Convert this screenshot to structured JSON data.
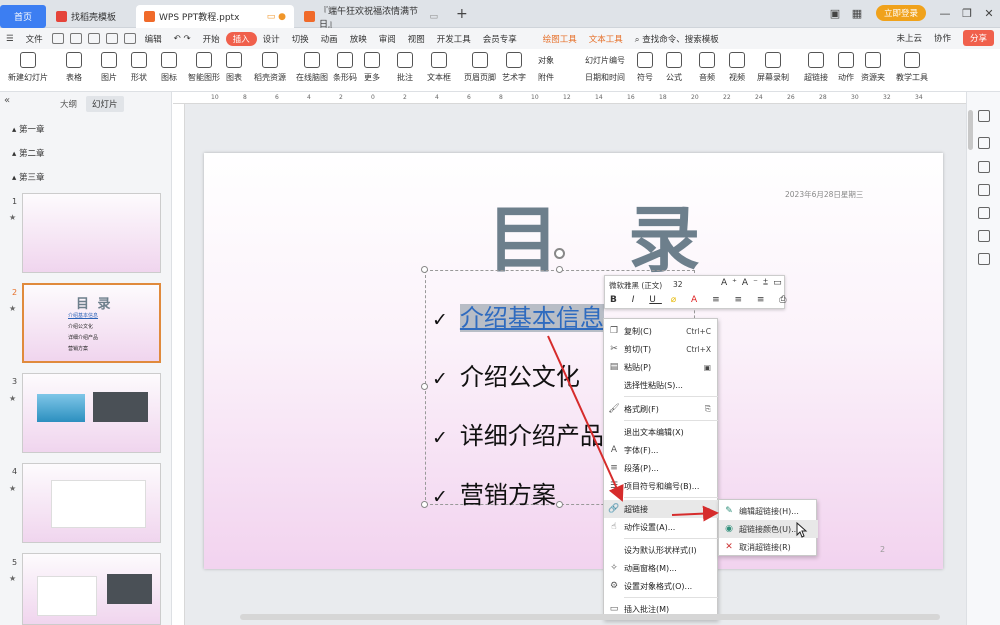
{
  "tabs": {
    "home": "首页",
    "find_template": "找稻壳模板",
    "current_file": "WPS PPT教程.pptx",
    "other_file": "『端午狂欢祝福浓情满节日』",
    "login": "立即登录"
  },
  "menu": {
    "file": "文件",
    "items": [
      "编辑",
      "开始",
      "插入",
      "设计",
      "切换",
      "动画",
      "放映",
      "审阅",
      "视图",
      "开发工具",
      "会员专享"
    ],
    "context_tools": [
      "绘图工具",
      "文本工具"
    ],
    "search_placeholder": "查找命令、搜索模板",
    "cloud": "未上云",
    "collab": "协作",
    "share": "分享"
  },
  "ribbon": {
    "items": [
      "新建幻灯片",
      "表格",
      "图片",
      "形状",
      "图标",
      "智能图形",
      "图表",
      "稻壳资源",
      "在线脑图",
      "条形码",
      "更多",
      "批注",
      "文本框",
      "页眉页脚",
      "艺术字",
      "音频",
      "视频",
      "屏幕录制",
      "超链接",
      "动作",
      "资源夹",
      "教学工具"
    ],
    "small": [
      "对象",
      "幻灯片编号",
      "附件",
      "日期和时间",
      "符号",
      "公式"
    ]
  },
  "left_panel": {
    "tab_outline": "大纲",
    "tab_slides": "幻灯片",
    "chapters": [
      "第一章",
      "第二章",
      "第三章"
    ],
    "slide_numbers": [
      "1",
      "2",
      "3",
      "4",
      "5"
    ],
    "thumb2_title": "目 录",
    "thumb2_items": [
      "介绍基本信息",
      "介绍公文化",
      "详细介绍产品",
      "营销方案"
    ]
  },
  "slide": {
    "title": "目 录",
    "date": "2023年6月28日星期三",
    "page_number": "2",
    "bullets": [
      "介绍基本信息",
      "介绍公文化",
      "详细介绍产品",
      "营销方案"
    ]
  },
  "format_bar": {
    "font": "微软雅黑 (正文)",
    "size": "32"
  },
  "context_menu": {
    "items": [
      {
        "label": "复制(C)",
        "shortcut": "Ctrl+C"
      },
      {
        "label": "剪切(T)",
        "shortcut": "Ctrl+X"
      },
      {
        "label": "粘贴(P)",
        "shortcut": ""
      },
      {
        "label": "选择性粘贴(S)...",
        "shortcut": ""
      },
      {
        "label": "格式刷(F)",
        "shortcut": ""
      },
      {
        "label": "退出文本编辑(X)",
        "shortcut": ""
      },
      {
        "label": "字体(F)...",
        "shortcut": ""
      },
      {
        "label": "段落(P)...",
        "shortcut": ""
      },
      {
        "label": "项目符号和编号(B)...",
        "shortcut": ""
      },
      {
        "label": "超链接",
        "shortcut": ""
      },
      {
        "label": "动作设置(A)...",
        "shortcut": ""
      },
      {
        "label": "设为默认形状样式(I)",
        "shortcut": ""
      },
      {
        "label": "动画窗格(M)...",
        "shortcut": ""
      },
      {
        "label": "设置对象格式(O)...",
        "shortcut": ""
      },
      {
        "label": "插入批注(M)",
        "shortcut": ""
      }
    ]
  },
  "submenu": {
    "items": [
      "编辑超链接(H)...",
      "超链接颜色(U)...",
      "取消超链接(R)"
    ]
  },
  "colors": {
    "accent_red": "#f0604c",
    "arrow_red": "#d62c2c",
    "link_blue": "#2f6bbf",
    "title_gray": "#6d7f8c"
  }
}
